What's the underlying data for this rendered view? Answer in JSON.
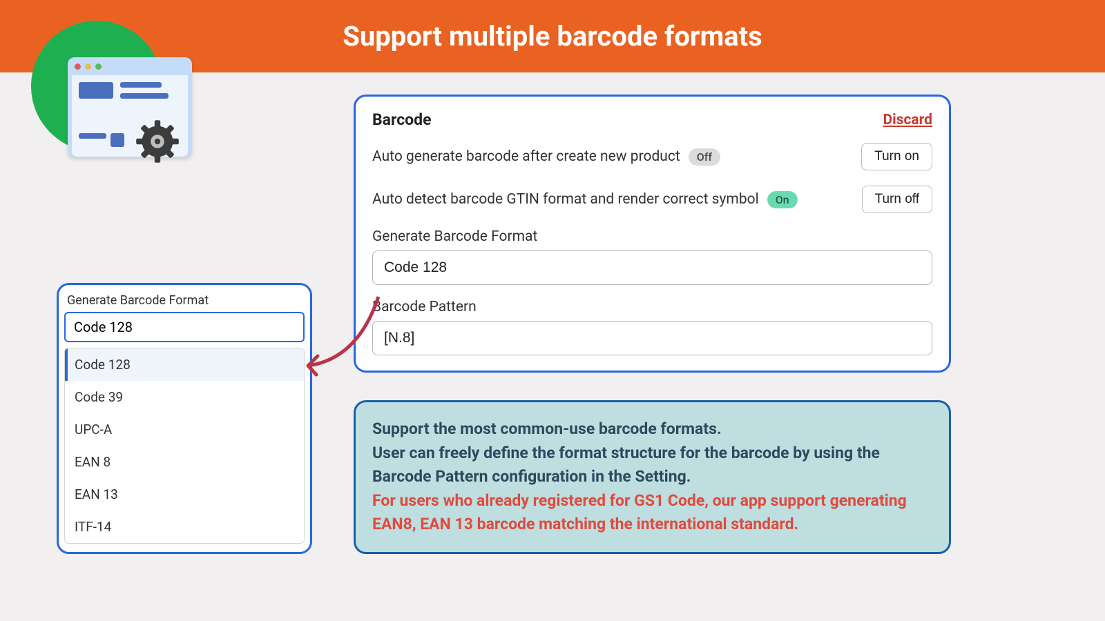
{
  "header": {
    "title": "Support multiple barcode formats"
  },
  "panel": {
    "title": "Barcode",
    "discard": "Discard",
    "settings": [
      {
        "label": "Auto generate barcode after create new product",
        "badge": "Off",
        "btn": "Turn on"
      },
      {
        "label": "Auto detect barcode GTIN format and render correct symbol",
        "badge": "On",
        "btn": "Turn off"
      }
    ],
    "format_label": "Generate Barcode Format",
    "format_value": "Code 128",
    "pattern_label": "Barcode Pattern",
    "pattern_value": "[N.8]"
  },
  "dropdown": {
    "label": "Generate Barcode Format",
    "selected": "Code 128",
    "options": [
      "Code 128",
      "Code 39",
      "UPC-A",
      "EAN 8",
      "EAN 13",
      "ITF-14"
    ]
  },
  "info": {
    "line1": "Support the most common-use barcode formats.",
    "line2": "User can freely define the format structure for the barcode by using the Barcode Pattern configuration in the Setting.",
    "line3": "For users who already registered for GS1 Code, our app support generating EAN8, EAN 13 barcode matching the international standard."
  }
}
